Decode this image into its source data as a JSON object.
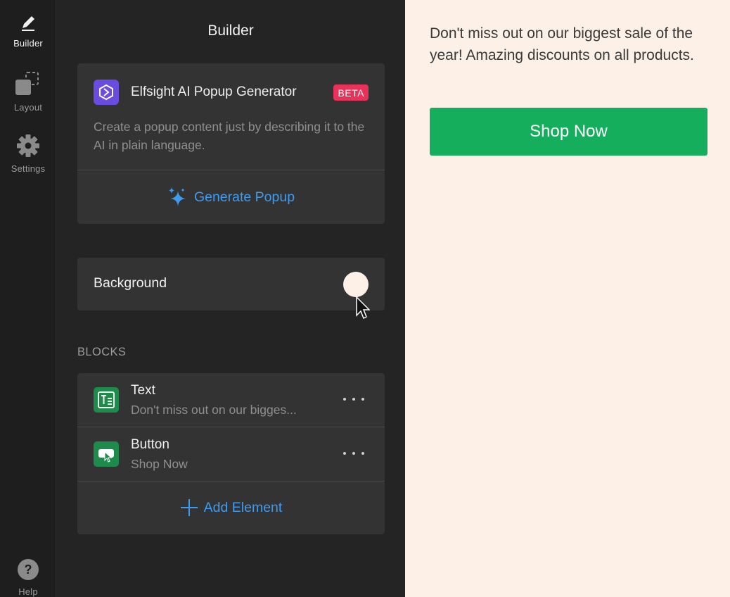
{
  "rail": {
    "builder": {
      "label": "Builder",
      "icon": "pencil-icon"
    },
    "layout": {
      "label": "Layout",
      "icon": "layout-icon"
    },
    "settings": {
      "label": "Settings",
      "icon": "gear-icon"
    },
    "help": {
      "label": "Help",
      "icon": "help-icon"
    }
  },
  "panel": {
    "title": "Builder",
    "ai_card": {
      "title": "Elfsight AI Popup Generator",
      "badge": "BETA",
      "description": "Create a popup content just by describing it to the AI in plain language.",
      "generate_label": "Generate Popup"
    },
    "background": {
      "label": "Background",
      "color": "#fdf0e7"
    },
    "blocks_heading": "BLOCKS",
    "blocks": [
      {
        "title": "Text",
        "subtitle": "Don't miss out on our bigges...",
        "icon": "text-block-icon"
      },
      {
        "title": "Button",
        "subtitle": "Shop Now",
        "icon": "button-block-icon"
      }
    ],
    "add_element_label": "Add Element"
  },
  "preview": {
    "text": "Don't miss out on our biggest sale of the year! Amazing discounts on all products.",
    "button_label": "Shop Now",
    "button_color": "#14ae5c",
    "background_color": "#fdf0e7"
  },
  "colors": {
    "accent": "#3f9bf0",
    "beta": "#e8325a",
    "ai_logo": "#6b4ce0",
    "block_icon": "#1e8a4c"
  }
}
